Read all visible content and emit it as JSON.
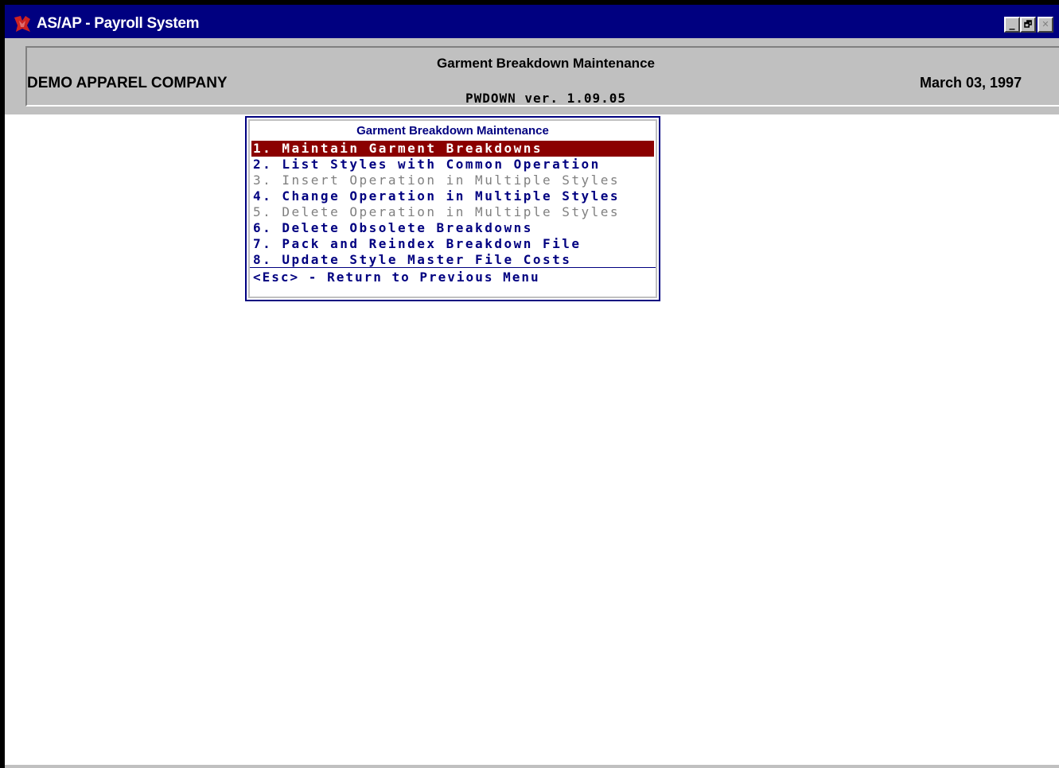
{
  "window": {
    "title": "AS/AP - Payroll System",
    "controls": {
      "minimize": "_",
      "maximize": "🗗",
      "close": "✕"
    }
  },
  "header": {
    "company": "DEMO APPAREL COMPANY",
    "screen_title": "Garment Breakdown Maintenance",
    "version": "PWDOWN ver. 1.09.05",
    "date": "March 03, 1997"
  },
  "menu": {
    "title": "Garment Breakdown Maintenance",
    "items": [
      {
        "label": "1. Maintain Garment Breakdowns",
        "state": "selected"
      },
      {
        "label": "2. List Styles with Common Operation",
        "state": "enabled"
      },
      {
        "label": "3. Insert Operation in Multiple Styles",
        "state": "disabled"
      },
      {
        "label": "4. Change Operation in Multiple Styles",
        "state": "enabled"
      },
      {
        "label": "5. Delete Operation in Multiple Styles",
        "state": "disabled"
      },
      {
        "label": "6. Delete Obsolete Breakdowns",
        "state": "enabled"
      },
      {
        "label": "7. Pack and Reindex Breakdown File",
        "state": "enabled"
      },
      {
        "label": "8. Update Style Master File Costs",
        "state": "enabled"
      }
    ],
    "esc_label": "<Esc> - Return to Previous Menu"
  },
  "colors": {
    "titlebar": "#000080",
    "menu_text": "#000080",
    "selection": "#8b0000",
    "disabled": "#808080",
    "chrome": "#c0c0c0"
  }
}
